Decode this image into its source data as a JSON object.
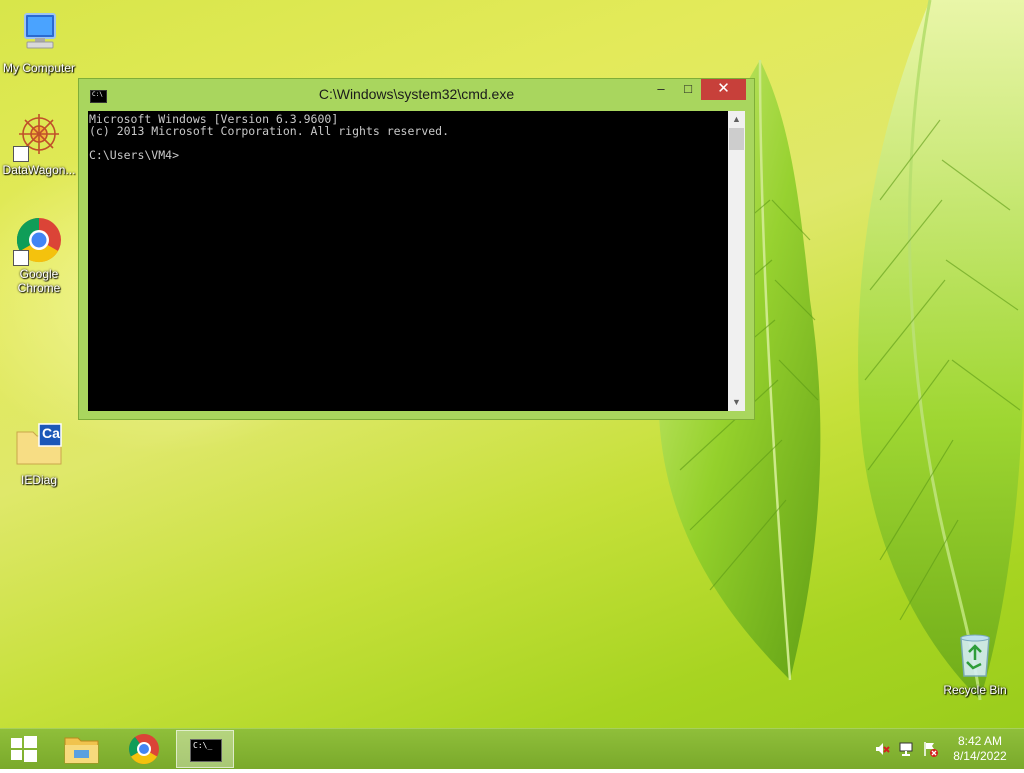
{
  "desktop": {
    "icons": [
      {
        "label": "My Computer"
      },
      {
        "label": "DataWagon..."
      },
      {
        "label": "Google Chrome"
      },
      {
        "label": "IEDiag"
      },
      {
        "label": "Recycle Bin"
      }
    ],
    "iediag_badge": "Ca"
  },
  "cmd_window": {
    "title": "C:\\Windows\\system32\\cmd.exe",
    "sysicon_text": "C:\\",
    "buttons": {
      "minimize": "–",
      "maximize": "□",
      "close": "✕"
    },
    "console_lines": [
      "Microsoft Windows [Version 6.3.9600]",
      "(c) 2013 Microsoft Corporation. All rights reserved.",
      "",
      "C:\\Users\\VM4>"
    ],
    "scroll_up": "▲",
    "scroll_down": "▼"
  },
  "taskbar": {
    "items": [
      "start-button",
      "file-explorer",
      "google-chrome",
      "command-prompt"
    ],
    "cmd_icon_text": "C:\\_",
    "clock": {
      "time": "8:42 AM",
      "date": "8/14/2022"
    }
  },
  "colors": {
    "taskbar": "#85b532",
    "window_frame": "#a9d65e",
    "close_button": "#c7403a",
    "console_bg": "#000000",
    "console_text": "#c8c8c8"
  }
}
